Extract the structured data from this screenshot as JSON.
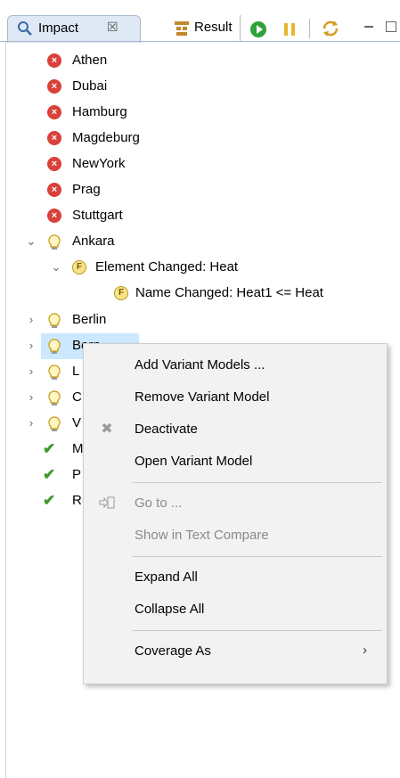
{
  "tabs": {
    "impact_label": "Impact",
    "impact_close": "☒",
    "result_label": "Result"
  },
  "tree": {
    "items": [
      {
        "label": "Athen",
        "icon": "error-icon"
      },
      {
        "label": "Dubai",
        "icon": "error-icon"
      },
      {
        "label": "Hamburg",
        "icon": "error-icon"
      },
      {
        "label": "Magdeburg",
        "icon": "error-icon"
      },
      {
        "label": "NewYork",
        "icon": "error-icon"
      },
      {
        "label": "Prag",
        "icon": "error-icon"
      },
      {
        "label": "Stuttgart",
        "icon": "error-icon"
      },
      {
        "label": "Ankara",
        "icon": "bulb-icon",
        "expanded": true
      },
      {
        "label": "Element Changed: Heat",
        "icon": "feature-icon",
        "expanded": true
      },
      {
        "label": "Name Changed: Heat1 <= Heat",
        "icon": "feature-icon"
      },
      {
        "label": "Berlin",
        "icon": "bulb-icon",
        "expanded": false
      },
      {
        "label": "Bern",
        "icon": "bulb-icon",
        "expanded": false
      },
      {
        "label": "L",
        "icon": "bulb-icon",
        "expanded": false,
        "selected": true
      },
      {
        "label": "C",
        "icon": "bulb-icon",
        "expanded": false
      },
      {
        "label": "V",
        "icon": "bulb-icon",
        "expanded": false
      },
      {
        "label": "M",
        "icon": "check-icon"
      },
      {
        "label": "P",
        "icon": "check-icon"
      },
      {
        "label": "R",
        "icon": "check-icon"
      }
    ]
  },
  "menu": {
    "add_variant_models": "Add Variant Models ...",
    "remove_variant_model": "Remove Variant Model",
    "deactivate": "Deactivate",
    "open_variant_model": "Open Variant Model",
    "go_to": "Go to ...",
    "show_in_text_compare": "Show in Text Compare",
    "expand_all": "Expand All",
    "collapse_all": "Collapse All",
    "coverage_as": "Coverage As"
  }
}
